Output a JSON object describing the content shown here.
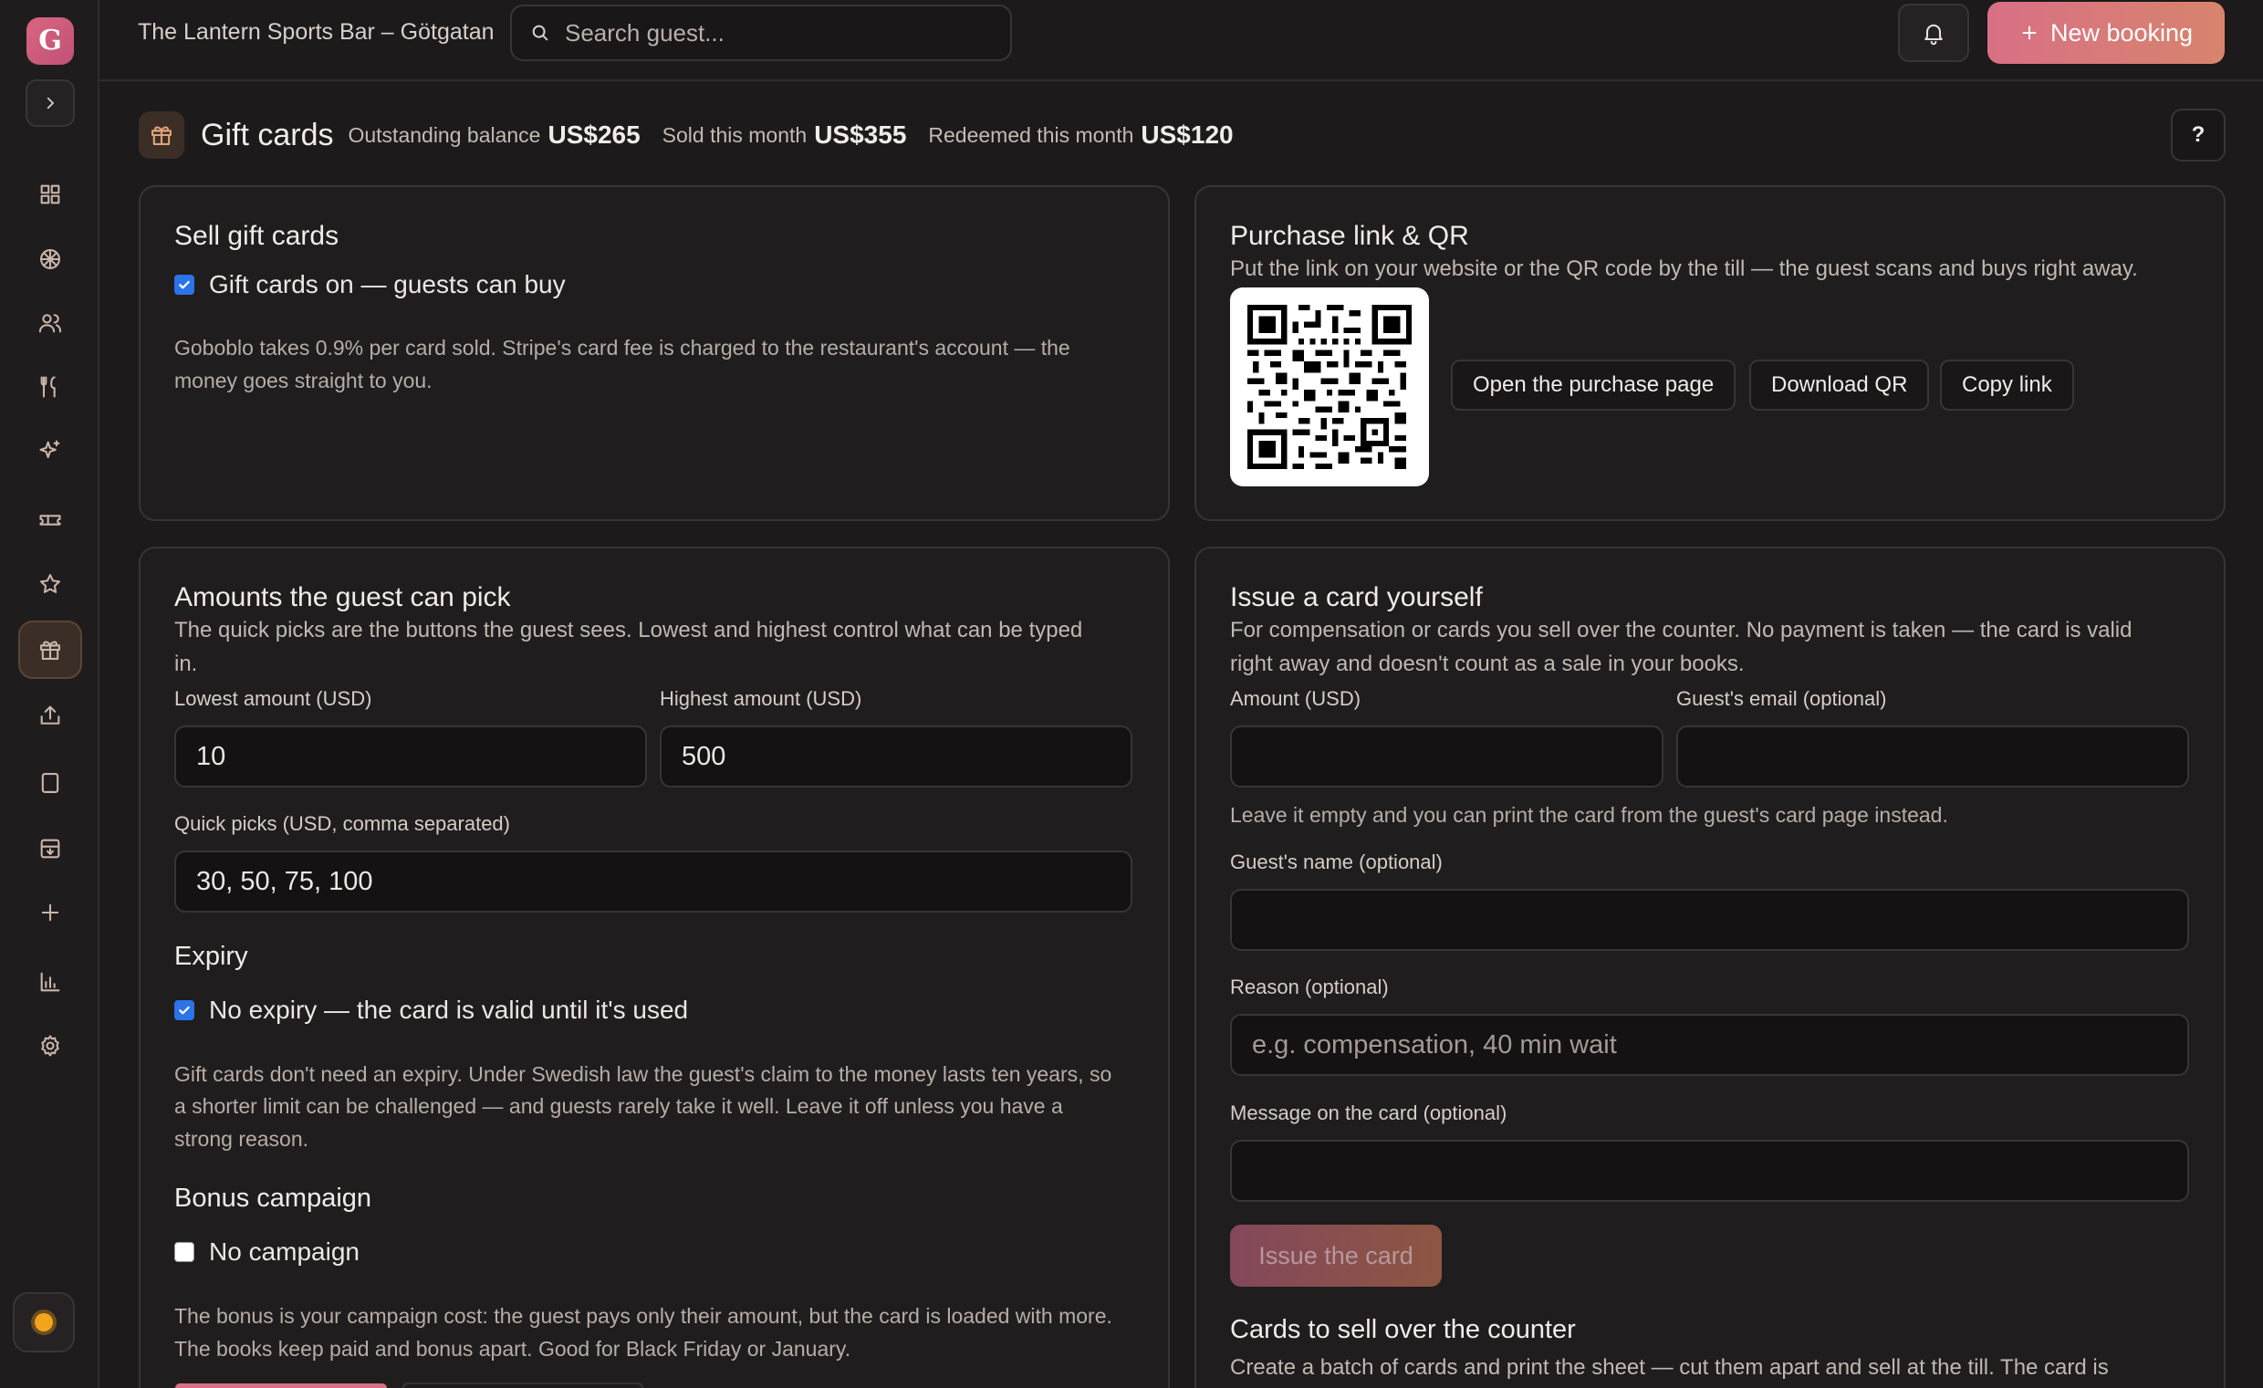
{
  "sidebar": {
    "brand_letter": "G",
    "items": [
      "grid-icon",
      "globe-icon",
      "users-icon",
      "utensils-icon",
      "sparkles-icon",
      "ticket-icon",
      "star-icon",
      "gift-icon",
      "upload-icon",
      "tablet-icon",
      "archive-icon",
      "plus-icon",
      "bar-chart-icon",
      "settings-icon"
    ],
    "active_item": "gift-icon"
  },
  "topbar": {
    "venue": "The Lantern Sports Bar – Götgatan",
    "search_placeholder": "Search guest...",
    "new_booking_label": "New booking"
  },
  "page": {
    "title": "Gift cards",
    "stats": [
      {
        "label": "Outstanding balance",
        "value": "US$265"
      },
      {
        "label": "Sold this month",
        "value": "US$355"
      },
      {
        "label": "Redeemed this month",
        "value": "US$120"
      }
    ],
    "help_label": "?"
  },
  "sell": {
    "title": "Sell gift cards",
    "toggle_label": "Gift cards on — guests can buy",
    "toggle_on": true,
    "note_line1": "Goboblo takes 0.9% per card sold. Stripe's card fee is charged to the restaurant's account — the",
    "note_line2": "money goes straight to you."
  },
  "purchase": {
    "title": "Purchase link & QR",
    "description": "Put the link on your website or the QR code by the till — the guest scans and buys right away.",
    "open_label": "Open the purchase page",
    "download_label": "Download QR",
    "copy_label": "Copy link"
  },
  "amounts": {
    "title": "Amounts the guest can pick",
    "desc_line1": "The quick picks are the buttons the guest sees. Lowest and highest control what can be typed",
    "desc_line2": "in.",
    "lowest_label": "Lowest amount (USD)",
    "lowest_value": "10",
    "highest_label": "Highest amount (USD)",
    "highest_value": "500",
    "quick_label": "Quick picks (USD, comma separated)",
    "quick_value": "30, 50, 75, 100",
    "expiry_heading": "Expiry",
    "expiry_toggle": "No expiry — the card is valid until it's used",
    "expiry_on": true,
    "expiry_note_1": "Gift cards don't need an expiry. Under Swedish law the guest's claim to the money lasts ten years, so",
    "expiry_note_2": "a shorter limit can be challenged — and guests rarely take it well. Leave it off unless you have a",
    "expiry_note_3": "strong reason.",
    "bonus_heading": "Bonus campaign",
    "bonus_toggle": "No campaign",
    "bonus_on": false,
    "bonus_note_1": "The bonus is your campaign cost: the guest pays only their amount, but the card is loaded with more.",
    "bonus_note_2": "The books keep paid and bonus apart. Good for Black Friday or January."
  },
  "issue": {
    "title": "Issue a card yourself",
    "desc_line1": "For compensation or cards you sell over the counter. No payment is taken — the card is valid",
    "desc_line2": "right away and doesn't count as a sale in your books.",
    "amount_label": "Amount (USD)",
    "amount_value": "",
    "email_label": "Guest's email (optional)",
    "email_value": "",
    "email_hint": "Leave it empty and you can print the card from the guest's card page instead.",
    "name_label": "Guest's name (optional)",
    "name_value": "",
    "reason_label": "Reason (optional)",
    "reason_placeholder": "e.g. compensation, 40 min wait",
    "message_label": "Message on the card (optional)",
    "message_value": "",
    "issue_label": "Issue the card",
    "counter_heading": "Cards to sell over the counter",
    "counter_desc": "Create a batch of cards and print the sheet — cut them apart and sell at the till. The card is"
  },
  "colors": {
    "accent_start": "#d87085",
    "accent_end": "#d7846d",
    "checkbox": "#2a73e8",
    "background": "#1d1a1b"
  }
}
